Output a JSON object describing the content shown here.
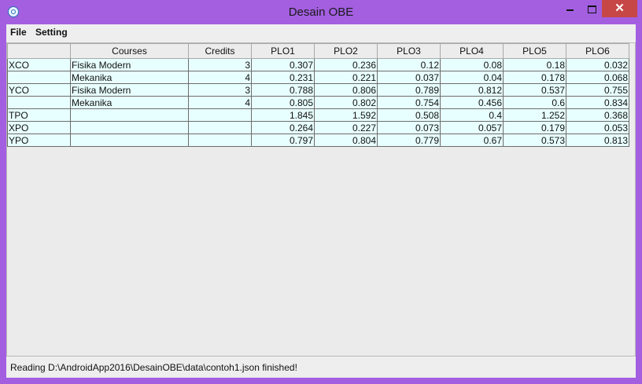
{
  "window": {
    "title": "Desain OBE",
    "close_glyph": "✕",
    "app_icon": "app-icon"
  },
  "menu": {
    "items": [
      "File",
      "Setting"
    ]
  },
  "table": {
    "columns": [
      "",
      "Courses",
      "Credits",
      "PLO1",
      "PLO2",
      "PLO3",
      "PLO4",
      "PLO5",
      "PLO6"
    ],
    "rows": [
      [
        "XCO",
        "Fisika Modern",
        "3",
        "0.307",
        "0.236",
        "0.12",
        "0.08",
        "0.18",
        "0.032"
      ],
      [
        "",
        "Mekanika",
        "4",
        "0.231",
        "0.221",
        "0.037",
        "0.04",
        "0.178",
        "0.068"
      ],
      [
        "YCO",
        "Fisika Modern",
        "3",
        "0.788",
        "0.806",
        "0.789",
        "0.812",
        "0.537",
        "0.755"
      ],
      [
        "",
        "Mekanika",
        "4",
        "0.805",
        "0.802",
        "0.754",
        "0.456",
        "0.6",
        "0.834"
      ],
      [
        "TPO",
        "",
        "",
        "1.845",
        "1.592",
        "0.508",
        "0.4",
        "1.252",
        "0.368"
      ],
      [
        "XPO",
        "",
        "",
        "0.264",
        "0.227",
        "0.073",
        "0.057",
        "0.179",
        "0.053"
      ],
      [
        "YPO",
        "",
        "",
        "0.797",
        "0.804",
        "0.779",
        "0.67",
        "0.573",
        "0.813"
      ]
    ]
  },
  "status": {
    "text": "Reading D:\\AndroidApp2016\\DesainOBE\\data\\contoh1.json finished!"
  },
  "colors": {
    "title_bar": "#a35fe0",
    "close_button": "#c74646",
    "cell_background": "#e8ffff",
    "client_background": "#eeeeee"
  }
}
